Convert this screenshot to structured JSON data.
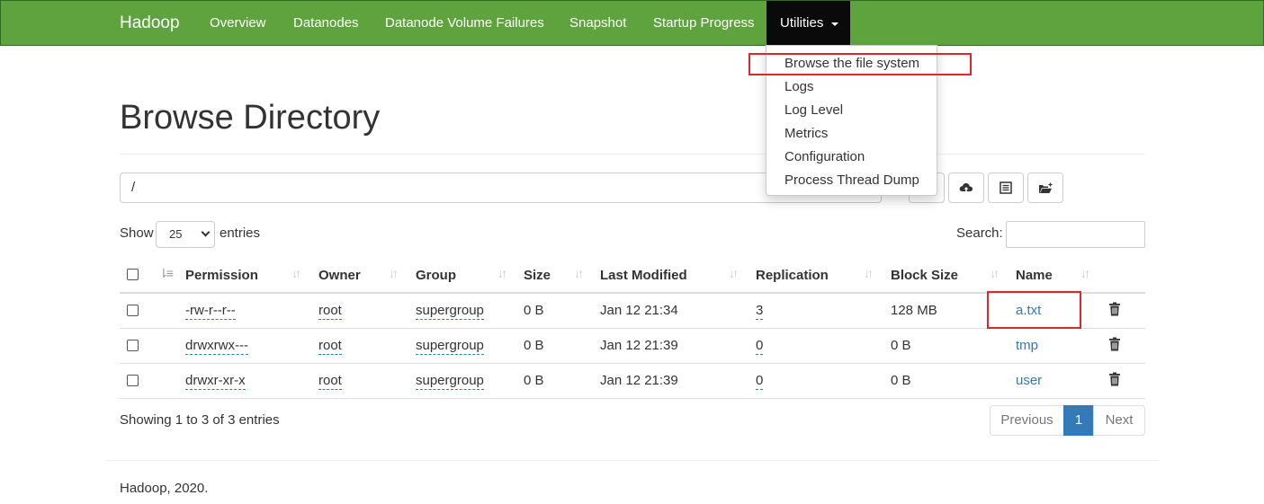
{
  "navbar": {
    "brand": "Hadoop",
    "links": [
      "Overview",
      "Datanodes",
      "Datanode Volume Failures",
      "Snapshot",
      "Startup Progress"
    ],
    "utilities": "Utilities"
  },
  "dropdown": {
    "items": [
      "Browse the file system",
      "Logs",
      "Log Level",
      "Metrics",
      "Configuration",
      "Process Thread Dump"
    ]
  },
  "page": {
    "title": "Browse Directory",
    "path_value": "/"
  },
  "icons": {
    "upload": "cloud-upload-icon",
    "list": "list-icon",
    "new_folder": "folder-open-icon",
    "delete": "trash-icon"
  },
  "controls": {
    "show_label": "Show",
    "show_value": "25",
    "entries_label": "entries",
    "search_label": "Search:"
  },
  "table": {
    "columns": [
      "Permission",
      "Owner",
      "Group",
      "Size",
      "Last Modified",
      "Replication",
      "Block Size",
      "Name"
    ],
    "rows": [
      {
        "permission": "-rw-r--r--",
        "owner": "root",
        "group": "supergroup",
        "size": "0 B",
        "modified": "Jan 12 21:34",
        "replication": "3",
        "block_size": "128 MB",
        "name": "a.txt"
      },
      {
        "permission": "drwxrwx---",
        "owner": "root",
        "group": "supergroup",
        "size": "0 B",
        "modified": "Jan 12 21:39",
        "replication": "0",
        "block_size": "0 B",
        "name": "tmp"
      },
      {
        "permission": "drwxr-xr-x",
        "owner": "root",
        "group": "supergroup",
        "size": "0 B",
        "modified": "Jan 12 21:39",
        "replication": "0",
        "block_size": "0 B",
        "name": "user"
      }
    ]
  },
  "pagination": {
    "info": "Showing 1 to 3 of 3 entries",
    "previous": "Previous",
    "current": "1",
    "next": "Next"
  },
  "footer": "Hadoop, 2020.",
  "colors": {
    "navbar": "#5fa33e",
    "link": "#337ab7",
    "highlight": "#e0262a"
  }
}
